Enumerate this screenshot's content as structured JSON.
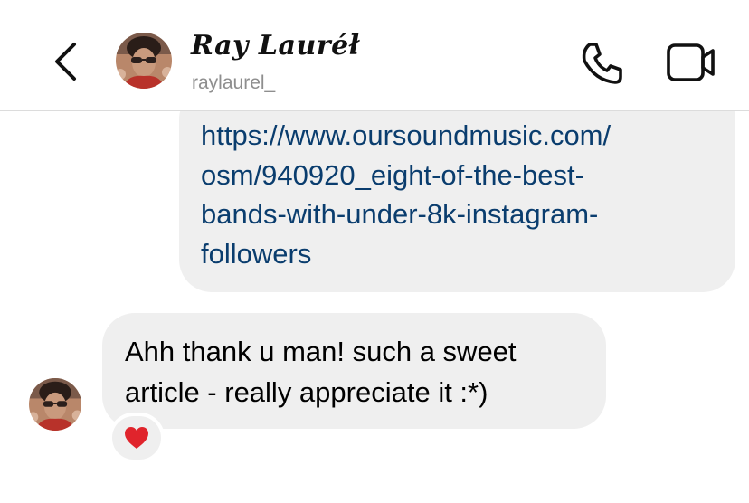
{
  "header": {
    "display_name": "Ray Lauréł",
    "username": "raylaurel_",
    "back_icon": "chevron-left-icon",
    "call_icon": "phone-icon",
    "video_icon": "video-camera-icon"
  },
  "messages": {
    "shared_link_lines": [
      "https://www.oursoundmusic.com/",
      "osm/940920_eight-of-the-best-",
      "bands-with-under-8k-instagram-",
      "followers"
    ],
    "reply_lines": [
      "Ahh thank u man! such a sweet",
      "article - really appreciate it :*)"
    ],
    "reaction": "❤️",
    "reaction_icon": "red-heart-icon"
  },
  "colors": {
    "bubble": "#efefef",
    "link": "#0a3d6e",
    "username": "#8e8e8e",
    "divider": "#dcdcdc"
  }
}
